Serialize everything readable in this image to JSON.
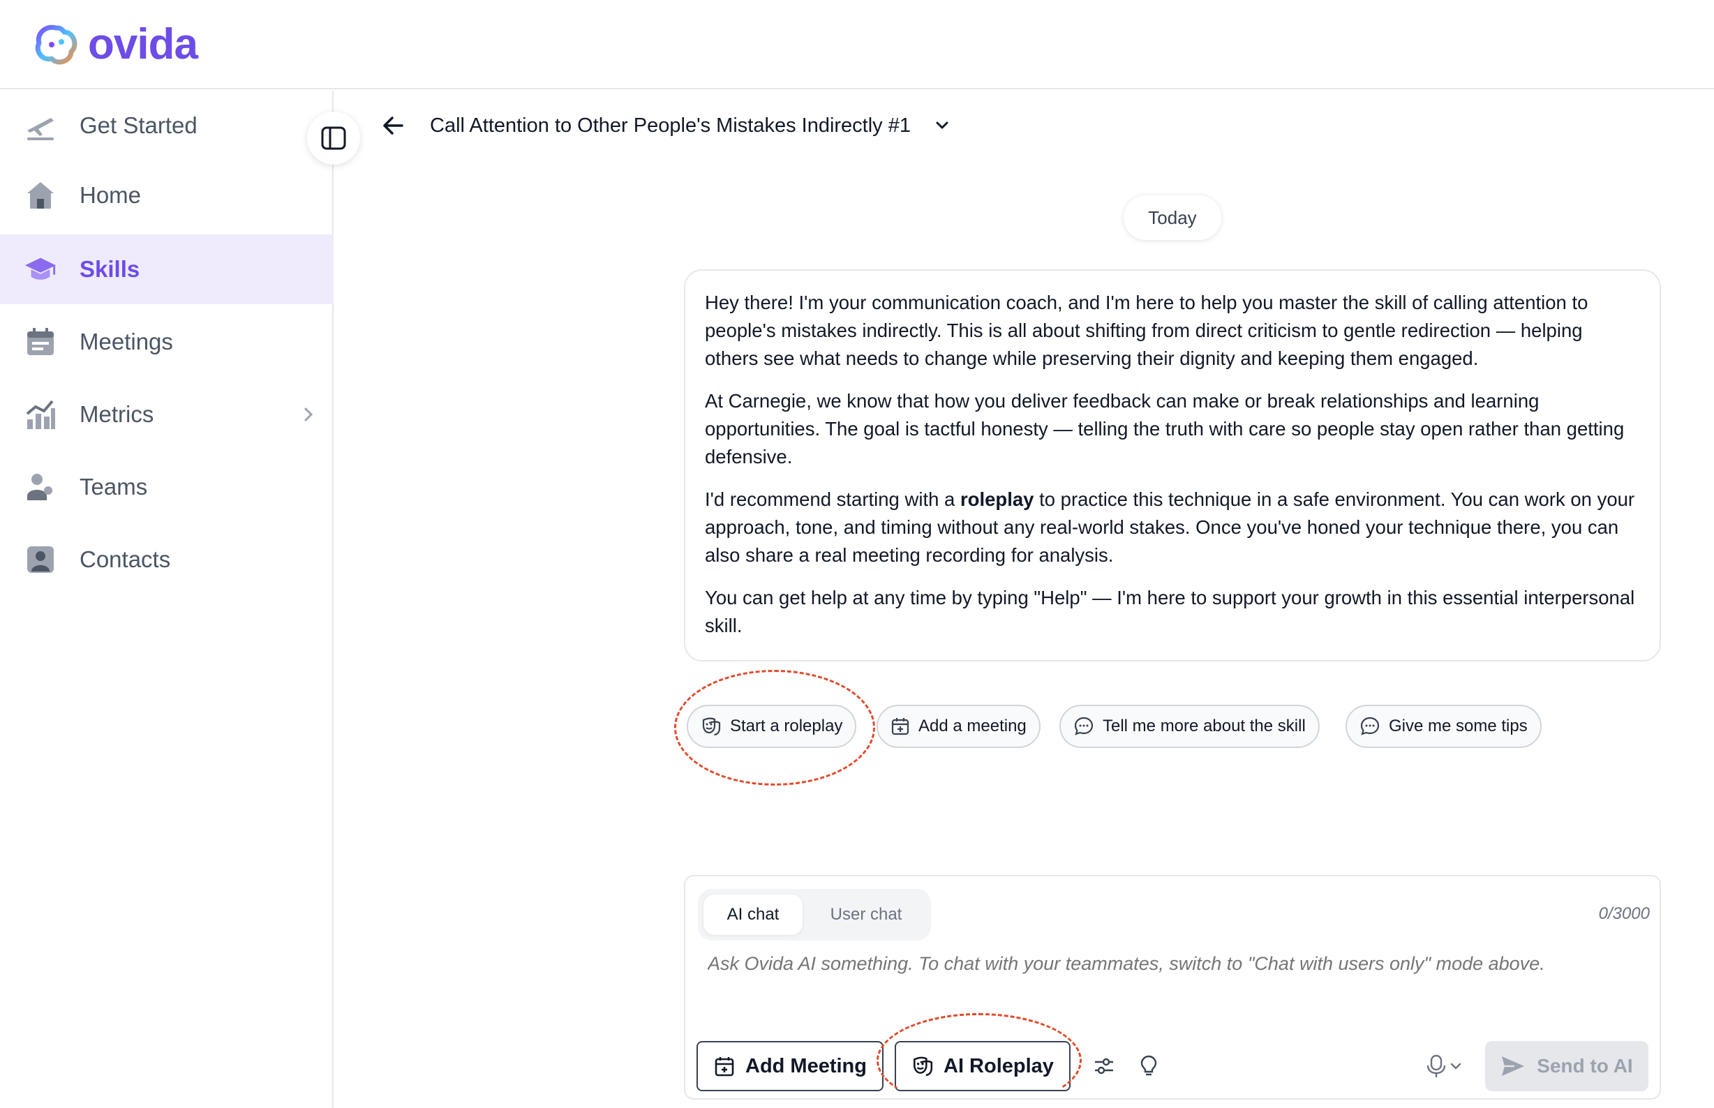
{
  "app": {
    "logo_text": "ovida"
  },
  "sidebar": {
    "items": [
      {
        "label": "Get Started",
        "icon": "plane-icon"
      },
      {
        "label": "Home",
        "icon": "home-icon"
      },
      {
        "label": "Skills",
        "icon": "graduation-cap-icon",
        "active": true
      },
      {
        "label": "Meetings",
        "icon": "calendar-icon"
      },
      {
        "label": "Metrics",
        "icon": "chart-icon",
        "has_submenu": true
      },
      {
        "label": "Teams",
        "icon": "people-icon"
      },
      {
        "label": "Contacts",
        "icon": "contact-icon"
      }
    ]
  },
  "header": {
    "title": "Call Attention to Other People's Mistakes Indirectly #1"
  },
  "chat": {
    "date_label": "Today",
    "message": {
      "p1": "Hey there! I'm your communication coach, and I'm here to help you master the skill of calling attention to people's mistakes indirectly. This is all about shifting from direct criticism to gentle redirection — helping others see what needs to change while preserving their dignity and keeping them engaged.",
      "p2": "At Carnegie, we know that how you deliver feedback can make or break relationships and learning opportunities. The goal is tactful honesty — telling the truth with care so people stay open rather than getting defensive.",
      "p3_before": "I'd recommend starting with a ",
      "p3_bold": "roleplay",
      "p3_after": " to practice this technique in a safe environment. You can work on your approach, tone, and timing without any real-world stakes. Once you've honed your technique there, you can also share a real meeting recording for analysis.",
      "p4": "You can get help at any time by typing \"Help\" — I'm here to support your growth in this essential interpersonal skill."
    },
    "suggestions": [
      {
        "label": "Start a roleplay",
        "icon": "theater-masks-icon"
      },
      {
        "label": "Add a meeting",
        "icon": "calendar-add-icon"
      },
      {
        "label": "Tell me more about the skill",
        "icon": "chat-bubble-icon"
      },
      {
        "label": "Give me some tips",
        "icon": "chat-bubble-icon"
      }
    ]
  },
  "composer": {
    "tabs": [
      "AI chat",
      "User chat"
    ],
    "active_tab": "AI chat",
    "counter": "0/3000",
    "placeholder": "Ask Ovida AI something. To chat with your teammates, switch to \"Chat with users only\" mode above.",
    "value": "",
    "add_meeting_label": "Add Meeting",
    "ai_roleplay_label": "AI Roleplay",
    "send_label": "Send to AI"
  },
  "colors": {
    "brand": "#6d4ce8",
    "active_bg": "#efebfd",
    "annotation": "#e24a2b",
    "disabled_bg": "#e5e7eb"
  }
}
